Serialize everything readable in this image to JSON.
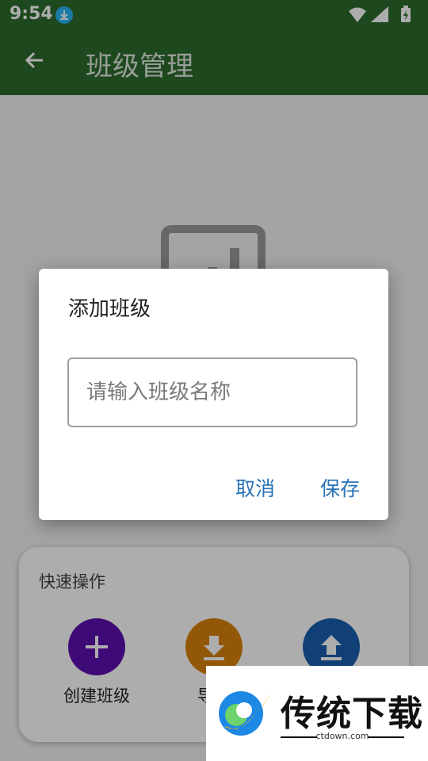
{
  "status_bar": {
    "time": "9:54"
  },
  "app_bar": {
    "title": "班级管理"
  },
  "quick_actions": {
    "title": "快速操作",
    "items": [
      {
        "label": "创建班级",
        "icon": "plus-icon",
        "color": "#5b0fb0"
      },
      {
        "label": "导出",
        "icon": "download-icon",
        "color": "#d9820b"
      },
      {
        "label": "",
        "icon": "upload-icon",
        "color": "#1a5fb0"
      }
    ]
  },
  "dialog": {
    "title": "添加班级",
    "input_placeholder": "请输入班级名称",
    "input_value": "",
    "cancel_label": "取消",
    "save_label": "保存"
  },
  "watermark": {
    "text": "传统下载",
    "sub": "ctdown.com"
  },
  "colors": {
    "app_bar": "#2d6a2d",
    "accent": "#2a73b8"
  }
}
